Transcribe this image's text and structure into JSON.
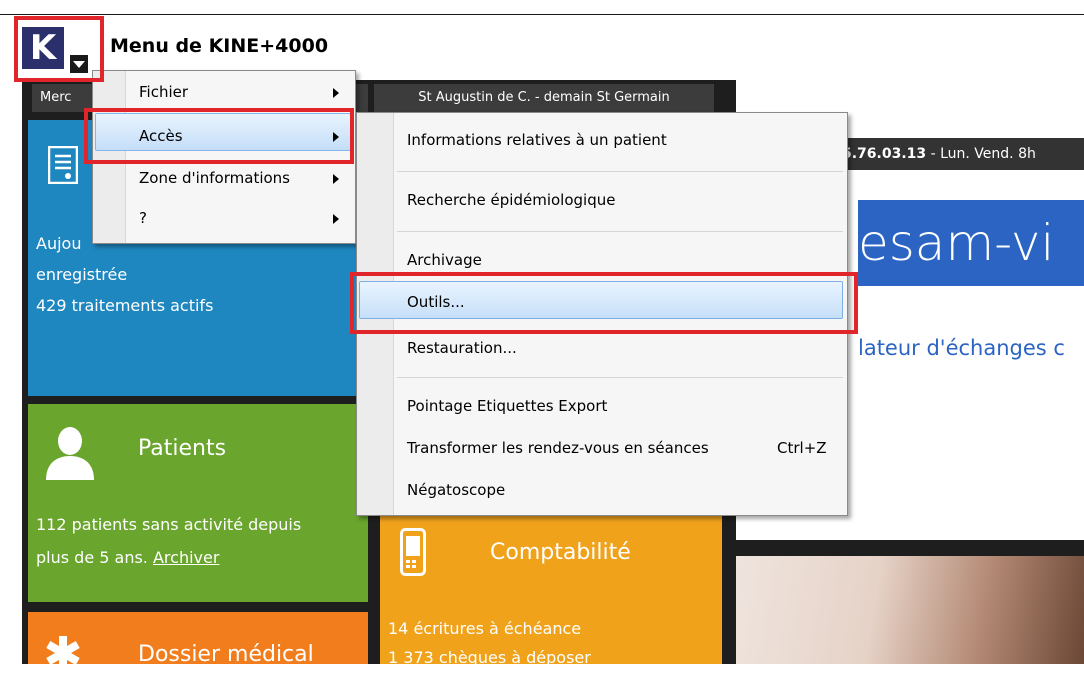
{
  "app": {
    "title": "Menu de KINE+4000",
    "logo_letter": "K"
  },
  "header": {
    "left_cell": "Merc",
    "right_cell": "St Augustin de C. - demain St Germain"
  },
  "tiles": {
    "rdv": {
      "line1": "Aujou",
      "line2": "enregistrée",
      "line3": "429 traitements actifs"
    },
    "patients": {
      "name": "Patients",
      "info_line1": "112 patients sans activité depuis",
      "info_line2_prefix": "plus de 5 ans.",
      "info_link": "Archiver"
    },
    "comptabilite": {
      "name": "Comptabilité",
      "info_line1": "14 écritures à échéance",
      "info_line2": "1 373 chèques à déposer"
    },
    "dossier": {
      "name": "Dossier médical"
    }
  },
  "right_panel": {
    "phone_bold": "5.76.03.13",
    "phone_rest": " - Lun. Vend. 8h",
    "banner_text": "esam-vi",
    "banner_sub": "lateur d'échanges c"
  },
  "main_menu": {
    "items": [
      {
        "label": "Fichier"
      },
      {
        "label": "Accès"
      },
      {
        "label": "Zone d'informations"
      },
      {
        "label": "?"
      }
    ]
  },
  "sub_menu": {
    "items": [
      {
        "label": "Informations relatives à un patient"
      },
      {
        "label": "Recherche épidémiologique"
      },
      {
        "label": "Archivage"
      },
      {
        "label": "Outils..."
      },
      {
        "label": "Restauration..."
      },
      {
        "label": "Pointage Etiquettes Export"
      },
      {
        "label": "Transformer les rendez-vous en séances",
        "shortcut": "Ctrl+Z"
      },
      {
        "label": "Négatoscope"
      }
    ]
  },
  "colors": {
    "blue_tile": "#1f87c0",
    "green_tile": "#6aa52d",
    "orange_tile": "#f0a21b",
    "red_tile": "#f27d1c",
    "annotation_red": "#e0262b"
  },
  "icons": {
    "logo_caret": "chevron-down-icon",
    "rdv": "document-icon",
    "patients": "person-icon",
    "comptabilite": "phone-icon",
    "dossier": "medical-star-icon"
  }
}
